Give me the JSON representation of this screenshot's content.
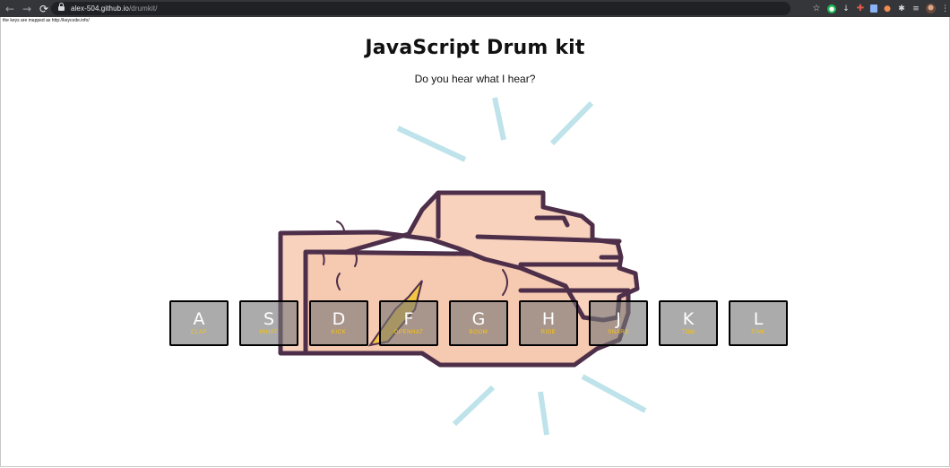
{
  "browser": {
    "nav": {
      "back_glyph": "←",
      "forward_glyph": "→",
      "reload_glyph": "⟳"
    },
    "url": {
      "host": "alex-504.github.io",
      "path": "/drumkit/"
    },
    "extensions": [
      "star-icon",
      "grammarly-icon",
      "pin-icon",
      "ext-red-icon",
      "doc-icon",
      "ext-orange-icon",
      "puzzle-icon",
      "reading-list-icon",
      "avatar",
      "menu-icon"
    ],
    "star_glyph": "☆",
    "menu_glyph": "⋮"
  },
  "page": {
    "note": "the keys are mapped as http://keycode.info/",
    "title": "JavaScript Drum kit",
    "subtitle": "Do you hear what I hear?"
  },
  "keys": [
    {
      "letter": "A",
      "sound": "clap"
    },
    {
      "letter": "S",
      "sound": "hihat"
    },
    {
      "letter": "D",
      "sound": "kick"
    },
    {
      "letter": "F",
      "sound": "openhat"
    },
    {
      "letter": "G",
      "sound": "boom"
    },
    {
      "letter": "H",
      "sound": "ride"
    },
    {
      "letter": "J",
      "sound": "snare"
    },
    {
      "letter": "K",
      "sound": "tom"
    },
    {
      "letter": "L",
      "sound": "tink"
    }
  ],
  "colors": {
    "key_letter": "#ffffff",
    "key_sound": "#ffc600",
    "key_bg": "rgba(120,120,120,0.62)",
    "hand_fill": "#f8d2bd",
    "hand_outline": "#4e2f4a",
    "burst": "#bfe3ea"
  }
}
